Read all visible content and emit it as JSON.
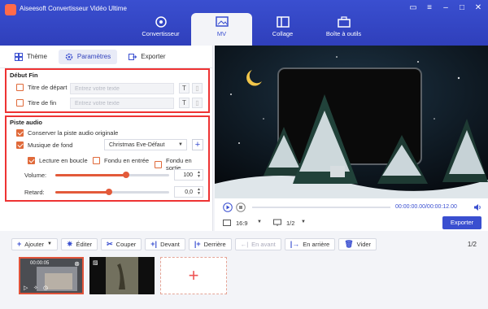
{
  "app": {
    "title": "Aiseesoft Convertisseur Vidéo Ultime"
  },
  "main_tabs": [
    {
      "label": "Convertisseur",
      "icon": "convert-icon"
    },
    {
      "label": "MV",
      "icon": "mv-icon",
      "active": true
    },
    {
      "label": "Collage",
      "icon": "collage-icon"
    },
    {
      "label": "Boîte à outils",
      "icon": "toolbox-icon"
    }
  ],
  "sub_tabs": [
    {
      "label": "Thème"
    },
    {
      "label": "Paramètres",
      "active": true
    },
    {
      "label": "Exporter"
    }
  ],
  "debut_fin": {
    "heading": "Début Fin",
    "start_label": "Titre de départ",
    "start_placeholder": "Entrez votre texte",
    "end_label": "Titre de fin",
    "end_placeholder": "Entrez votre texte",
    "text_btn": "T"
  },
  "audio": {
    "heading": "Piste audio",
    "keep_original": "Conserver la piste audio originale",
    "bg_music": "Musique de fond",
    "music_select": "Christmas Eve-Défaut",
    "loop": "Lecture en boucle",
    "fade_in": "Fondu en entrée",
    "fade_out": "Fondu en sortie",
    "volume_label": "Volume:",
    "volume_value": "100",
    "volume_fill": 0.62,
    "delay_label": "Retard:",
    "delay_value": "0,0",
    "delay_fill": 0.47,
    "plus": "+"
  },
  "player": {
    "time": "00:00:00.00/00:00:12.00",
    "ratio": "16:9",
    "pages": "1/2",
    "export": "Exporter"
  },
  "toolbar": {
    "add": "Ajouter",
    "edit": "Éditer",
    "cut": "Couper",
    "front": "Devant",
    "back": "Derrière",
    "forward": "En avant",
    "backward": "En arrière",
    "clear": "Vider",
    "page": "1/2"
  },
  "timeline": {
    "clip1_time": "00:00:05",
    "add": "+"
  },
  "colors": {
    "accent": "#3a4fd0",
    "highlight": "#e33333",
    "orange": "#e06a3a"
  }
}
